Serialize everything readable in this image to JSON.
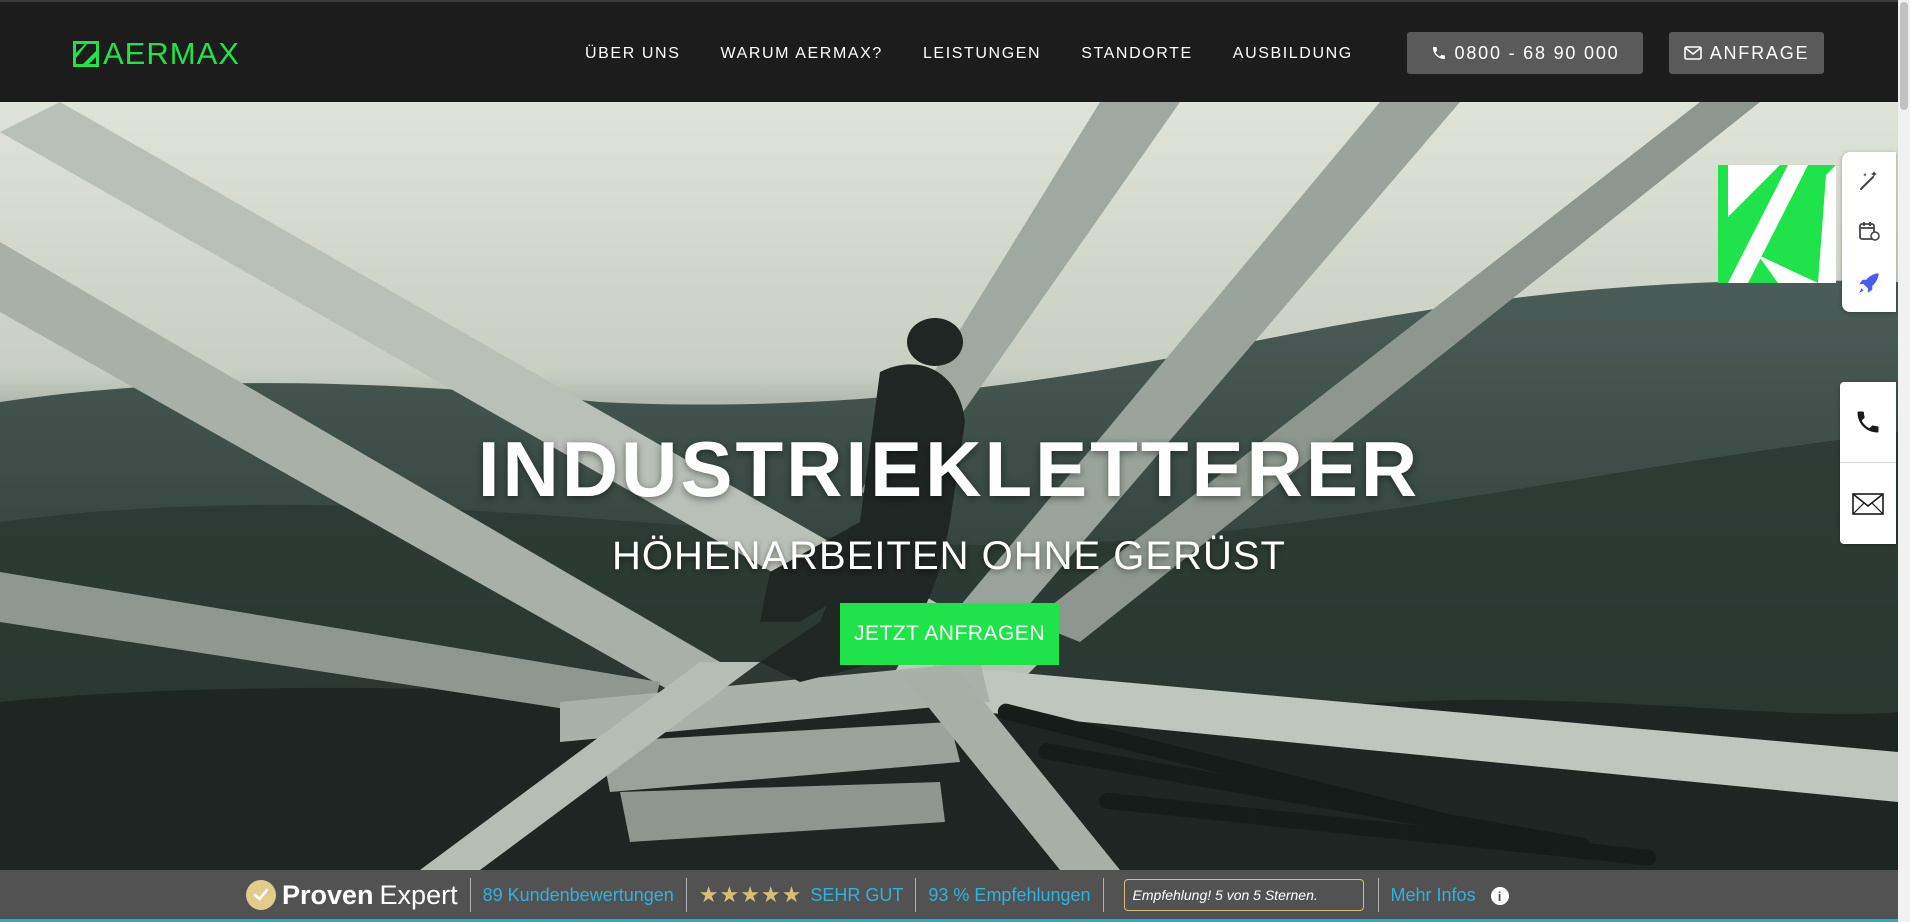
{
  "header": {
    "logo_text": "AERMAX",
    "nav": [
      {
        "label": "ÜBER UNS"
      },
      {
        "label": "WARUM AERMAX?"
      },
      {
        "label": "LEISTUNGEN"
      },
      {
        "label": "STANDORTE"
      },
      {
        "label": "AUSBILDUNG"
      }
    ],
    "phone_label": "0800 - 68 90 000",
    "inquiry_label": "ANFRAGE"
  },
  "hero": {
    "title": "INDUSTRIEKLETTERER",
    "subtitle": "HÖHENARBEITEN OHNE GERÜST",
    "cta_label": "JETZT ANFRAGEN"
  },
  "side_tools": {
    "icons": [
      "wand-sparkles-icon",
      "calendar-edit-icon",
      "rocket-icon"
    ]
  },
  "contact_widget": {
    "icons": [
      "phone-icon",
      "envelope-icon"
    ]
  },
  "proven_expert": {
    "brand_bold": "Proven",
    "brand_light": "Expert",
    "reviews": "89 Kundenbewertungen",
    "stars": "★★★★★",
    "rating_label": "SEHR GUT",
    "recommendations": "93 % Empfehlungen",
    "quote": "Empfehlung! 5 von 5 Sternen.",
    "more_info": "Mehr Infos"
  },
  "colors": {
    "brand_green": "#1fe34a",
    "header_bg": "#1c1c1c",
    "button_gray": "#5a5a5a",
    "link_blue": "#2fb3dc",
    "gold": "#d6be75"
  }
}
